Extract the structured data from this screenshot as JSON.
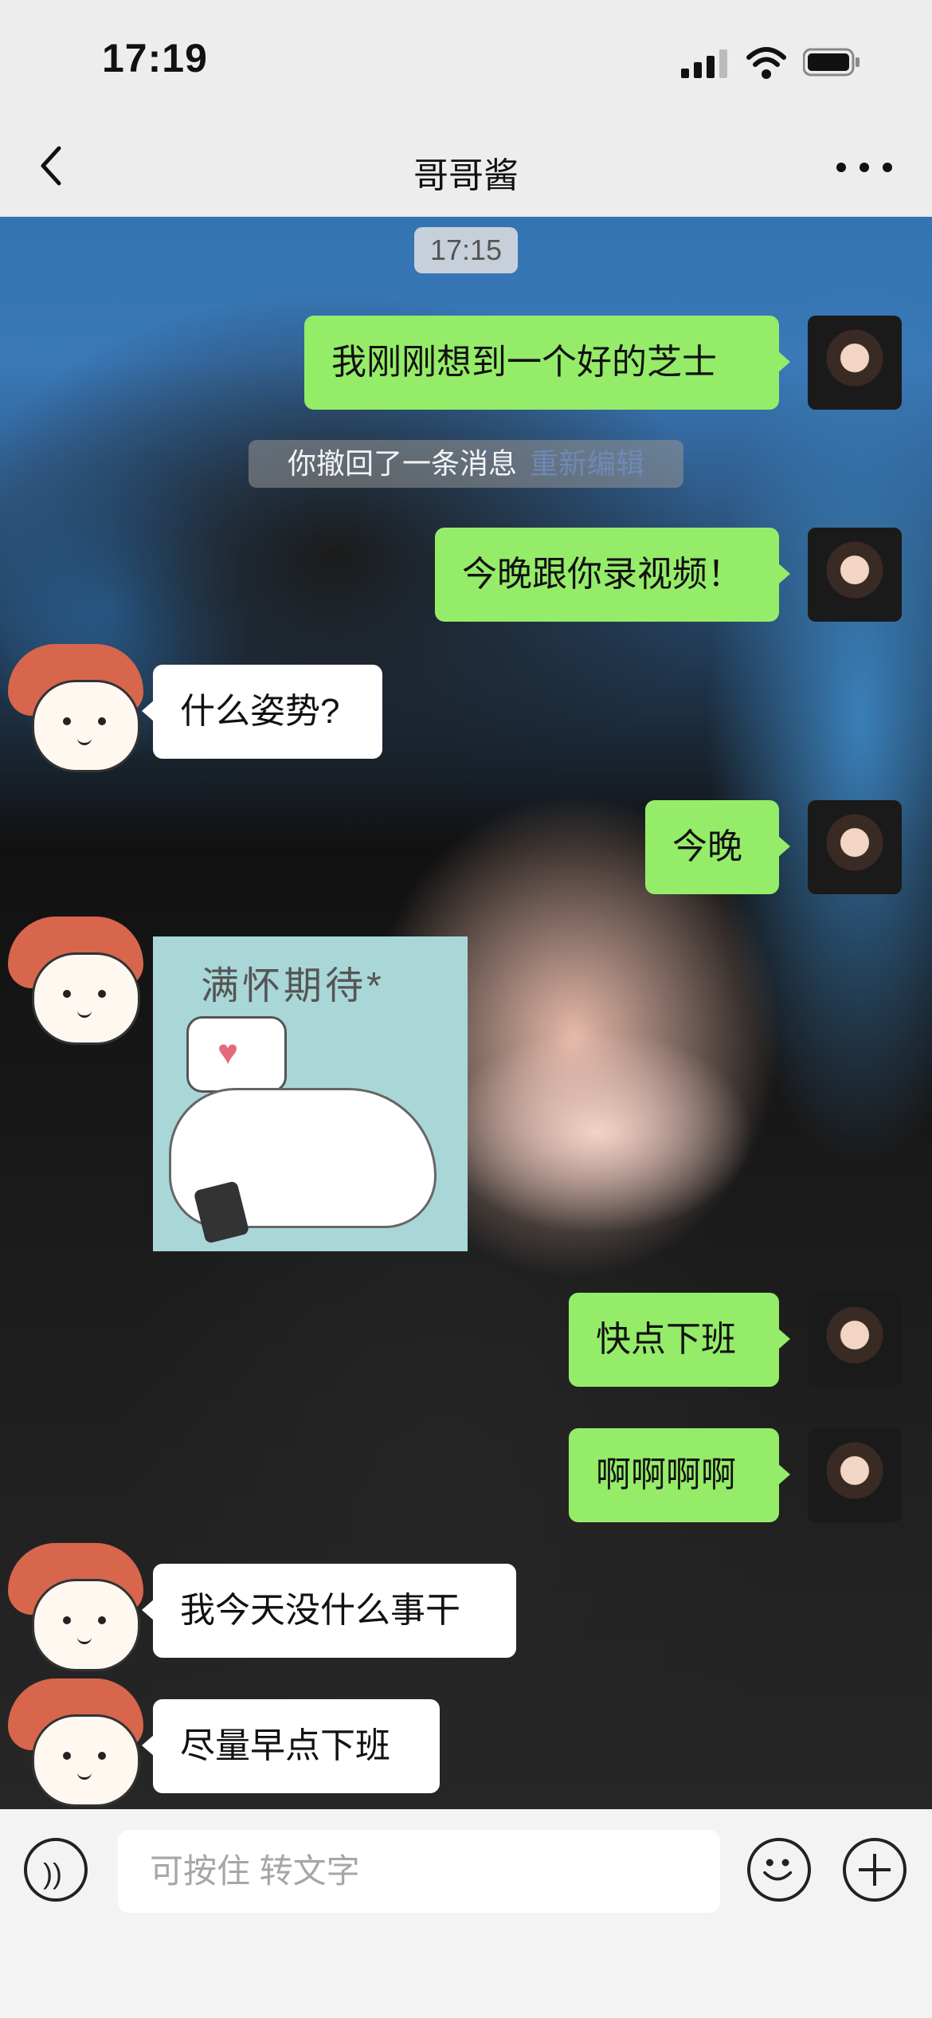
{
  "status": {
    "time": "17:19"
  },
  "nav": {
    "title": "哥哥酱"
  },
  "chat": {
    "timestamp": "17:15",
    "system": {
      "text": "你撤回了一条消息",
      "edit": "重新编辑"
    },
    "messages": [
      {
        "side": "right",
        "text": "我刚刚想到一个好的芝士"
      },
      {
        "side": "right",
        "text": "今晚跟你录视频！"
      },
      {
        "side": "left",
        "text": "什么姿势?"
      },
      {
        "side": "right",
        "text": "今晚"
      },
      {
        "side": "left",
        "type": "sticker",
        "text": "满怀期待*"
      },
      {
        "side": "right",
        "text": "快点下班"
      },
      {
        "side": "right",
        "text": "啊啊啊啊"
      },
      {
        "side": "left",
        "text": "我今天没什么事干"
      },
      {
        "side": "left",
        "text": "尽量早点下班"
      }
    ]
  },
  "input": {
    "placeholder": "可按住 转文字"
  },
  "icons": {
    "back": "chevron-left-icon",
    "more": "more-icon",
    "voice": "voice-icon",
    "emoji": "emoji-icon",
    "plus": "plus-icon"
  },
  "colors": {
    "self_bubble": "#95ec69",
    "other_bubble": "#ffffff",
    "header_bg": "#ededed"
  }
}
